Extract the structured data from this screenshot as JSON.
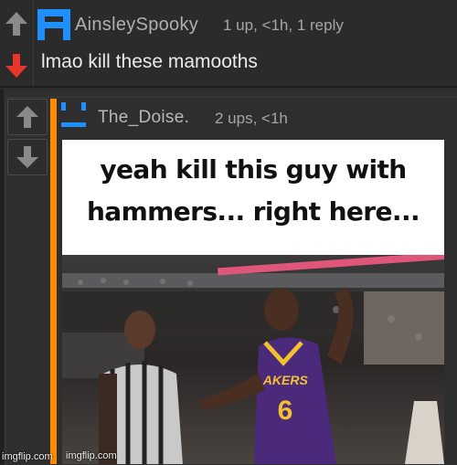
{
  "comments": [
    {
      "username": "AinsleySpooky",
      "meta": "1 up, <1h, 1 reply",
      "text": "lmao kill these mamooths",
      "colors": {
        "avatar": "#1e90ff",
        "downvote_active": "#e8362a"
      }
    },
    {
      "username": "The_Doise.",
      "meta": "2 ups, <1h",
      "colors": {
        "avatar": "#1e90ff",
        "thread_bar": "#ff8a00"
      },
      "image": {
        "caption_line1": "yeah kill this guy with",
        "caption_line2": "hammers... right here...",
        "jersey_text": "LAKERS",
        "jersey_number": "6",
        "watermark_inner": "imgflip.com",
        "watermark_outer": "imgflip.com"
      }
    }
  ],
  "icons": {
    "upvote": "arrow-up-icon",
    "downvote": "arrow-down-icon",
    "avatar": "pixel-face-icon"
  }
}
